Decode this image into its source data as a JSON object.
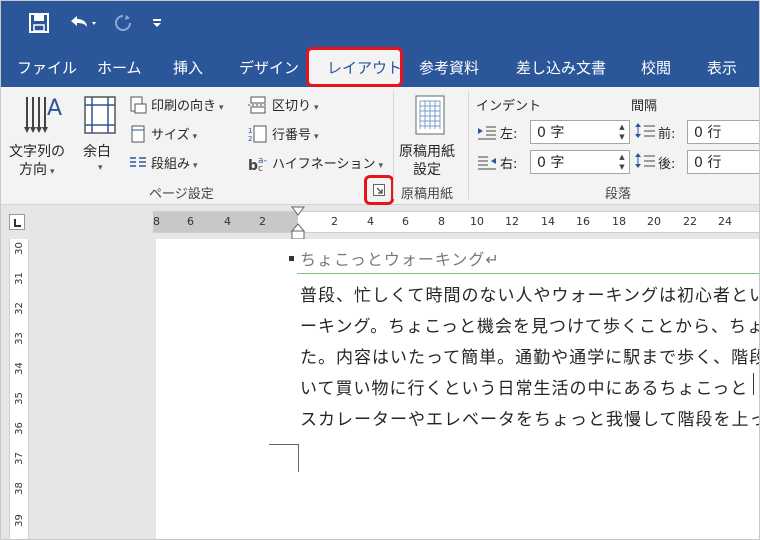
{
  "quick_access": {
    "save_icon": "save-icon",
    "undo_icon": "undo-icon",
    "redo_icon": "redo-icon",
    "customize_icon": "customize-icon"
  },
  "tabs": [
    {
      "label": "ファイル"
    },
    {
      "label": "ホーム"
    },
    {
      "label": "挿入"
    },
    {
      "label": "デザイン"
    },
    {
      "label": "レイアウト"
    },
    {
      "label": "参考資料"
    },
    {
      "label": "差し込み文書"
    },
    {
      "label": "校閲"
    },
    {
      "label": "表示"
    }
  ],
  "ribbon": {
    "page_setup": {
      "text_direction_line1": "文字列の",
      "text_direction_line2": "方向",
      "margins_label": "余白",
      "orientation_label": "印刷の向き",
      "size_label": "サイズ",
      "columns_label": "段組み",
      "breaks_label": "区切り",
      "line_numbers_label": "行番号",
      "hyphenation_label": "ハイフネーション",
      "group_label": "ページ設定"
    },
    "genko": {
      "settings_line1": "原稿用紙",
      "settings_line2": "設定",
      "group_label": "原稿用紙"
    },
    "paragraph": {
      "indent_heading": "インデント",
      "spacing_heading": "間隔",
      "left_label": "左:",
      "left_value": "0 字",
      "right_label": "右:",
      "right_value": "0 字",
      "before_label": "前:",
      "before_value": "0 行",
      "after_label": "後:",
      "after_value": "0 行",
      "group_label": "段落"
    }
  },
  "hruler_numbers": [
    "8",
    "6",
    "4",
    "2",
    "2",
    "4",
    "6",
    "8",
    "10",
    "12",
    "14",
    "16",
    "18",
    "20",
    "22",
    "24"
  ],
  "vruler_numbers": [
    "30",
    "31",
    "32",
    "33",
    "34",
    "35",
    "36",
    "37",
    "38",
    "39"
  ],
  "document": {
    "heading": "ちょこっとウォーキング↵",
    "lines": [
      "普段、忙しくて時間のない人やウォーキングは初心者とい",
      "ーキング。ちょこっと機会を見つけて歩くことから、ちょ",
      "た。内容はいたって簡単。通勤や通学に駅まで歩く、階段",
      "いて買い物に行くという日常生活の中にあるちょこっと",
      "スカレーターやエレベータをちょっと我慢して階段を上っ"
    ]
  },
  "colors": {
    "ribbon_blue": "#2b579a",
    "highlight_red": "#e8141c"
  }
}
